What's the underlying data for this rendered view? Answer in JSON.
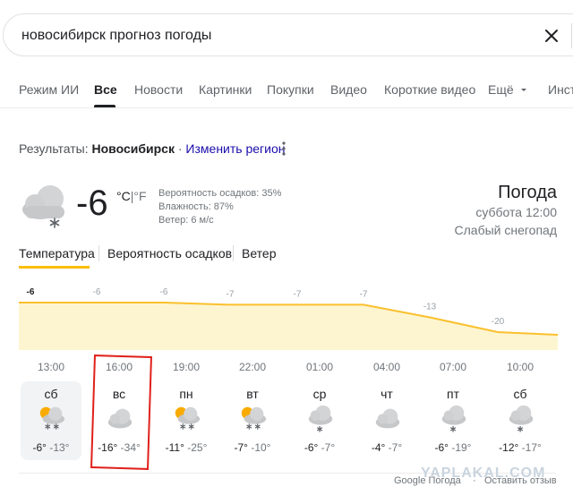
{
  "search": {
    "query": "новосибирск прогноз погоды"
  },
  "tabs": [
    {
      "label": "Режим ИИ"
    },
    {
      "label": "Все"
    },
    {
      "label": "Новости"
    },
    {
      "label": "Картинки"
    },
    {
      "label": "Покупки"
    },
    {
      "label": "Видео"
    },
    {
      "label": "Короткие видео"
    },
    {
      "label": "Ещё"
    },
    {
      "label": "Инст"
    }
  ],
  "results": {
    "prefix": "Результаты:",
    "city": "Новосибирск",
    "sep": " · ",
    "change_region": "Изменить регион"
  },
  "weather": {
    "temp": "-6",
    "unit_c": "°C",
    "unit_sep": "|",
    "unit_f": "°F",
    "precip": "Вероятность осадков: 35%",
    "humidity": "Влажность: 87%",
    "wind": "Ветер: 6 м/с",
    "title": "Погода",
    "time": "суббота 12:00",
    "condition": "Слабый снегопад"
  },
  "metric_tabs": [
    {
      "label": "Температура"
    },
    {
      "label": "Вероятность осадков"
    },
    {
      "label": "Ветер"
    }
  ],
  "chart_data": {
    "type": "area",
    "x": [
      "13:00",
      "16:00",
      "19:00",
      "22:00",
      "01:00",
      "04:00",
      "07:00",
      "10:00"
    ],
    "values": [
      -6,
      -6,
      -6,
      -7,
      -7,
      -7,
      -13,
      -20
    ],
    "value_labels": [
      "-6",
      "-6",
      "-6",
      "-7",
      "-7",
      "-7",
      "-13",
      "-20"
    ],
    "colors": {
      "line": "#fbc02d",
      "fill": "#fdf5d0"
    }
  },
  "days": [
    {
      "name": "сб",
      "hi": "-6°",
      "lo": "-13°",
      "icon": "sun-cloud-snow-icon"
    },
    {
      "name": "вс",
      "hi": "-16°",
      "lo": "-34°",
      "icon": "cloud-icon"
    },
    {
      "name": "пн",
      "hi": "-11°",
      "lo": "-25°",
      "icon": "sun-cloud-snow-icon"
    },
    {
      "name": "вт",
      "hi": "-7°",
      "lo": "-10°",
      "icon": "sun-cloud-snow-icon"
    },
    {
      "name": "ср",
      "hi": "-6°",
      "lo": "-7°",
      "icon": "cloud-snow-icon"
    },
    {
      "name": "чт",
      "hi": "-4°",
      "lo": "-7°",
      "icon": "cloud-icon"
    },
    {
      "name": "пт",
      "hi": "-6°",
      "lo": "-19°",
      "icon": "cloud-snow-icon"
    },
    {
      "name": "сб",
      "hi": "-12°",
      "lo": "-17°",
      "icon": "cloud-snow-icon"
    }
  ],
  "footer": {
    "source": "Google Погода",
    "dot": "·",
    "feedback": "Оставить отзыв"
  },
  "watermark": "YAPLAKAL.COM"
}
